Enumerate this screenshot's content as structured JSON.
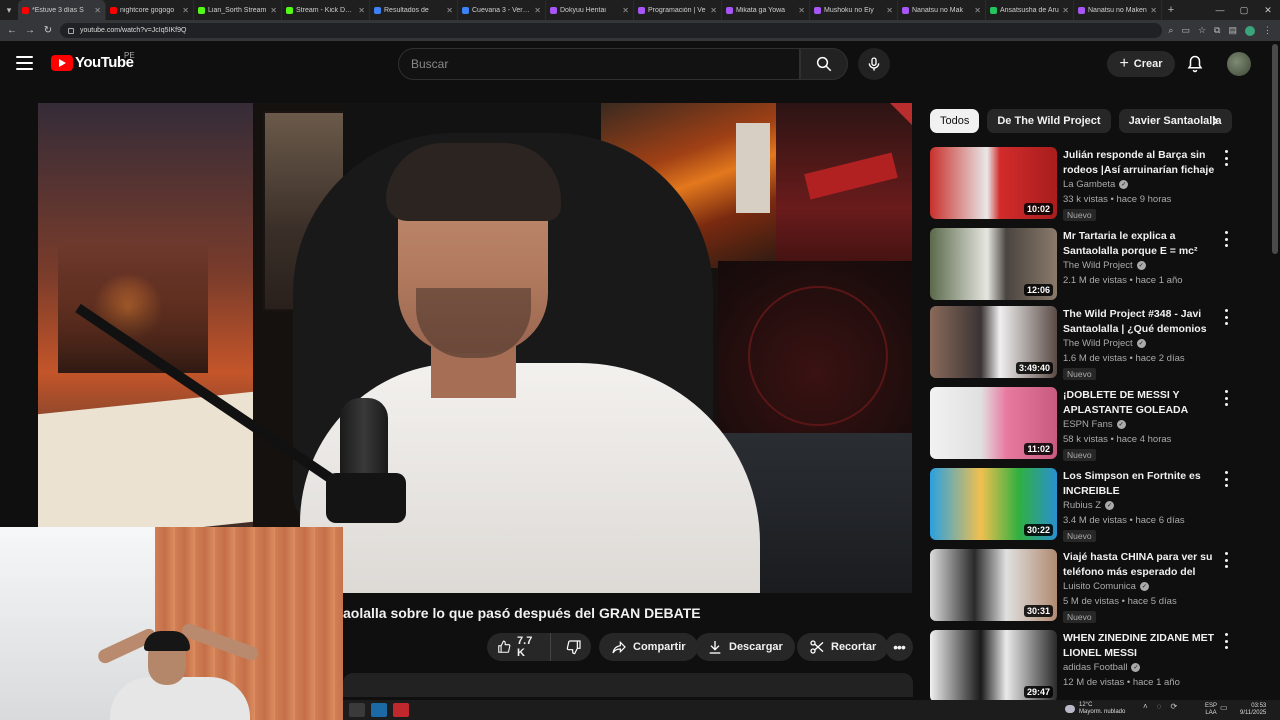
{
  "browser": {
    "tabs": [
      {
        "title": "*Estuve 3 días S",
        "color": "#ff0000",
        "active": true
      },
      {
        "title": "nightcore gogogo",
        "color": "#ff0000",
        "active": false
      },
      {
        "title": "Lian_Sorth Stream",
        "color": "#53fc18",
        "active": false
      },
      {
        "title": "Stream - Kick Dash",
        "color": "#53fc18",
        "active": false
      },
      {
        "title": "Resultados de",
        "color": "#3b82f6",
        "active": false
      },
      {
        "title": "Cuevana 3 - Ver Pel",
        "color": "#3b82f6",
        "active": false
      },
      {
        "title": "Dokyuu Hentai",
        "color": "#a855f7",
        "active": false
      },
      {
        "title": "Programación | Ve",
        "color": "#a855f7",
        "active": false
      },
      {
        "title": "Mikata ga Yowa",
        "color": "#a855f7",
        "active": false
      },
      {
        "title": "Mushoku no Eiy",
        "color": "#a855f7",
        "active": false
      },
      {
        "title": "Nanatsu no Mak",
        "color": "#a855f7",
        "active": false
      },
      {
        "title": "Ansatsusha de Aru",
        "color": "#22c55e",
        "active": false
      },
      {
        "title": "Nanatsu no Maken",
        "color": "#a855f7",
        "active": false
      }
    ],
    "url": "youtube.com/watch?v=JcIq5IKf9Q"
  },
  "header": {
    "logo_text": "YouTube",
    "country": "PE",
    "search_placeholder": "Buscar",
    "create_label": "Crear"
  },
  "video": {
    "title": "aolalla sobre lo que pasó después del GRAN DEBATE",
    "likes": "7.7 K",
    "share_label": "Compartir",
    "download_label": "Descargar",
    "clip_label": "Recortar"
  },
  "chips": [
    "Todos",
    "De The Wild Project",
    "Javier Santaolalla"
  ],
  "recommendations": [
    {
      "title": "Julián responde al Barça sin rodeos |Así arruinarían fichaje ...",
      "channel": "La Gambeta",
      "meta": "33 k vistas • hace 9 horas",
      "duration": "10:02",
      "badge": "Nuevo",
      "thumb": "linear-gradient(90deg,#c9302c 0%,#e8e8e8 45%,#d22b2b 55%,#a81d1d 100%)"
    },
    {
      "title": "Mr Tartaria le explica a Santaolalla porque E = mc² est...",
      "channel": "The Wild Project",
      "meta": "2.1 M de vistas • hace 1 año",
      "duration": "12:06",
      "badge": "",
      "thumb": "linear-gradient(90deg,#5a6a4a 0%,#e6e6e0 45%,#4a4440 60%,#8a7a6a 100%)"
    },
    {
      "title": "The Wild Project #348 - Javi Santaolalla | ¿Qué demonios ...",
      "channel": "The Wild Project",
      "meta": "1.6 M de vistas • hace 2 días",
      "duration": "3:49:40",
      "badge": "Nuevo",
      "thumb": "linear-gradient(90deg,#8a6a5a 0%,#3a3434 40%,#f0f0f0 55%,#5a4a44 100%)"
    },
    {
      "title": "¡DOBLETE DE MESSI Y APLASTANTE GOLEADA PARA...",
      "channel": "ESPN Fans",
      "meta": "58 k vistas • hace 4 horas",
      "duration": "11:02",
      "badge": "Nuevo",
      "thumb": "linear-gradient(90deg,#f2f2f2 0%,#e0e0e0 40%,#e87aa0 60%,#c85a80 100%)"
    },
    {
      "title": "Los Simpson en Fortnite es INCREIBLE",
      "channel": "Rubius Z",
      "meta": "3.4 M de vistas • hace 6 días",
      "duration": "30:22",
      "badge": "Nuevo",
      "thumb": "linear-gradient(90deg,#2aa0e0 0%,#f0c050 40%,#30b040 70%,#2a90d0 100%)"
    },
    {
      "title": "Viajé hasta CHINA para ver su teléfono más esperado del añ...",
      "channel": "Luisito Comunica",
      "meta": "5 M de vistas • hace 5 días",
      "duration": "30:31",
      "badge": "Nuevo",
      "thumb": "linear-gradient(90deg,#dcdcdc 0%,#2a2a2a 35%,#e0e0e0 60%,#b08a70 100%)"
    },
    {
      "title": "WHEN ZINEDINE ZIDANE MET LIONEL MESSI",
      "channel": "adidas Football",
      "meta": "12 M de vistas • hace 1 año",
      "duration": "29:47",
      "badge": "",
      "thumb": "linear-gradient(90deg,#f0f0f0 0%,#1a1a1a 40%,#eaeaea 60%,#2a2a2a 100%)"
    }
  ],
  "taskbar": {
    "temp": "12°C",
    "weather": "Mayorm. nublado",
    "lang": "ESP",
    "lang2": "LAA",
    "time": "03:53",
    "date": "9/11/2025"
  },
  "colors": {
    "accent": "#ff0000",
    "bg": "#0f0f0f",
    "chip": "#272727"
  }
}
